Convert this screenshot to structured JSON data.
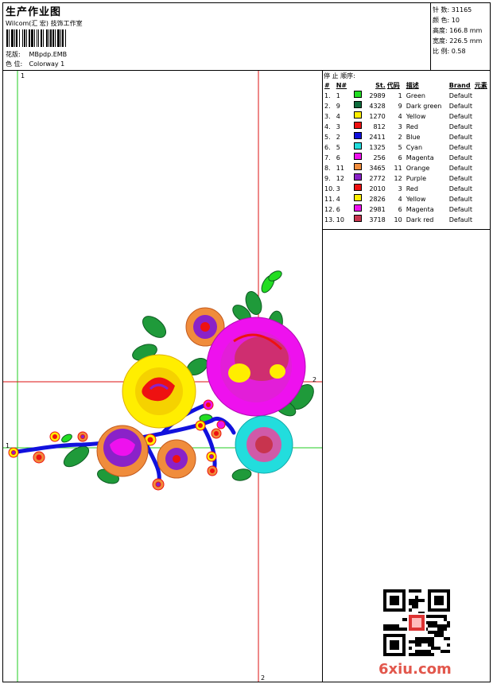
{
  "header": {
    "title": "生产作业图",
    "subtitle": "Wilcom(汇 宏) 技饰工作室",
    "design_label": "花版:",
    "design_value": "MBpdp.EMB",
    "colorway_label": "色 位:",
    "colorway_value": "Colorway 1"
  },
  "stats": [
    {
      "label": "针 数:",
      "value": "31165"
    },
    {
      "label": "颜 色:",
      "value": "10"
    },
    {
      "label": "高度:",
      "value": "166.8 mm"
    },
    {
      "label": "宽度:",
      "value": "226.5 mm"
    },
    {
      "label": "比 例:",
      "value": "0.58"
    }
  ],
  "stops": {
    "title": "停 止 顺序:",
    "headers": [
      "#",
      "N#",
      "St.",
      "代码",
      "描述",
      "Brand",
      "元素"
    ],
    "rows": [
      {
        "n": "1.",
        "code": "1",
        "color": "#22dd22",
        "st": "2989",
        "num": "1",
        "desc": "Green",
        "brand": "Default"
      },
      {
        "n": "2.",
        "code": "9",
        "color": "#0e6b3c",
        "st": "4328",
        "num": "9",
        "desc": "Dark green",
        "brand": "Default"
      },
      {
        "n": "3.",
        "code": "4",
        "color": "#ffee00",
        "st": "1270",
        "num": "4",
        "desc": "Yellow",
        "brand": "Default"
      },
      {
        "n": "4.",
        "code": "3",
        "color": "#ee1111",
        "st": "812",
        "num": "3",
        "desc": "Red",
        "brand": "Default"
      },
      {
        "n": "5.",
        "code": "2",
        "color": "#1111dd",
        "st": "2411",
        "num": "2",
        "desc": "Blue",
        "brand": "Default"
      },
      {
        "n": "6.",
        "code": "5",
        "color": "#22dddd",
        "st": "1325",
        "num": "5",
        "desc": "Cyan",
        "brand": "Default"
      },
      {
        "n": "7.",
        "code": "6",
        "color": "#ee11ee",
        "st": "256",
        "num": "6",
        "desc": "Magenta",
        "brand": "Default"
      },
      {
        "n": "8.",
        "code": "11",
        "color": "#f08c3c",
        "st": "3465",
        "num": "11",
        "desc": "Orange",
        "brand": "Default"
      },
      {
        "n": "9.",
        "code": "12",
        "color": "#8a22c8",
        "st": "2772",
        "num": "12",
        "desc": "Purple",
        "brand": "Default"
      },
      {
        "n": "10.",
        "code": "3",
        "color": "#ee1111",
        "st": "2010",
        "num": "3",
        "desc": "Red",
        "brand": "Default"
      },
      {
        "n": "11.",
        "code": "4",
        "color": "#ffee00",
        "st": "2826",
        "num": "4",
        "desc": "Yellow",
        "brand": "Default"
      },
      {
        "n": "12.",
        "code": "6",
        "color": "#ee11ee",
        "st": "2981",
        "num": "6",
        "desc": "Magenta",
        "brand": "Default"
      },
      {
        "n": "13.",
        "code": "10",
        "color": "#c8344e",
        "st": "3718",
        "num": "10",
        "desc": "Dark red",
        "brand": "Default"
      }
    ]
  },
  "guides": {
    "green_label": "1",
    "red_label": "2"
  },
  "watermark": "6xiu.com",
  "colors": {
    "guide_green": "#22cc22",
    "guide_red": "#dd1111"
  }
}
